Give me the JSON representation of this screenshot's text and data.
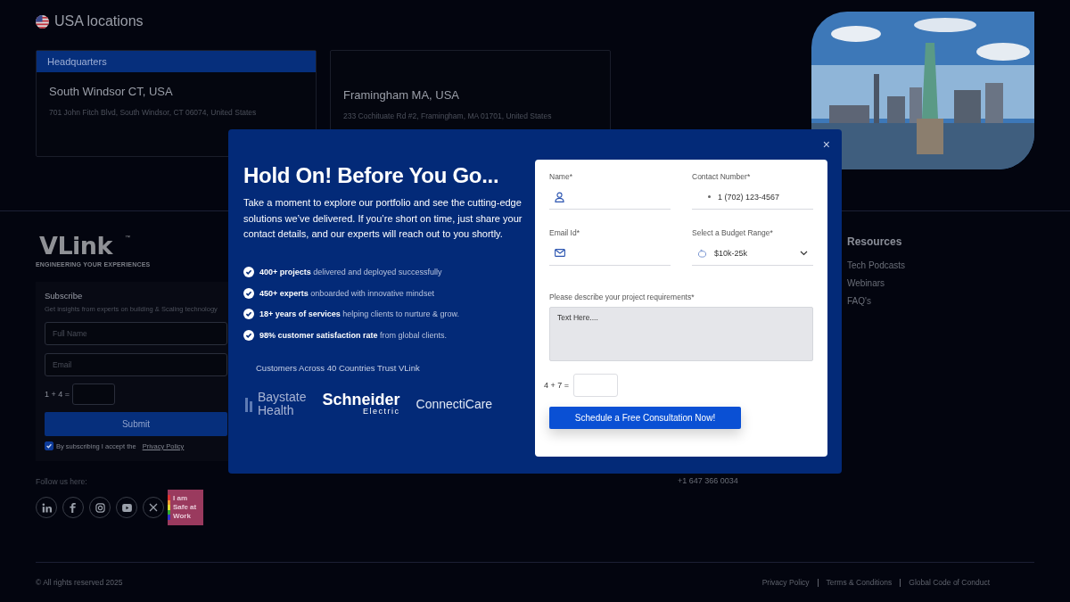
{
  "locations": {
    "title": "USA locations",
    "offices": [
      {
        "tag": "Headquarters",
        "city": "South Windsor CT, USA",
        "address": "701 John Fitch Blvd, South Windsor, CT 06074, United States"
      },
      {
        "city": "Framingham MA, USA",
        "address": "233 Cochituate Rd #2, Framingham, MA 01701, United States"
      }
    ]
  },
  "footer": {
    "logo": {
      "name": "VLink",
      "mark": "™",
      "tagline": "ENGINEERING YOUR EXPERIENCES"
    },
    "subscribe": {
      "title": "Subscribe",
      "subtitle": "Get insights from experts on building & Scaling technology",
      "name_placeholder": "Full Name",
      "email_placeholder": "Email",
      "captcha": "1 + 4 =",
      "button": "Submit",
      "consent_checked": true,
      "consent_text": "By subscribing I accept the",
      "consent_link": "Privacy Policy"
    },
    "follow_label": "Follow us here:",
    "social_links": [
      {
        "kind": "linkedin"
      },
      {
        "kind": "facebook"
      },
      {
        "kind": "instagram"
      },
      {
        "kind": "youtube"
      },
      {
        "kind": "x"
      }
    ],
    "badge": "I am Safe at Work",
    "phone": "+1 647 366 0034",
    "resources": {
      "title": "Resources",
      "links": [
        "Tech Podcasts",
        "Webinars",
        "FAQ's"
      ]
    },
    "copyright": "© All rights reserved 2025",
    "legal_links": [
      "Privacy Policy",
      "Terms & Conditions",
      "Global Code of Conduct"
    ]
  },
  "modal": {
    "close": "×",
    "title": "Hold On! Before You Go...",
    "intro": "Take a moment to explore our portfolio and see the cutting-edge solutions we’ve delivered. If you’re short on time, just share your contact details, and our experts will reach out to you shortly.",
    "highlights": [
      "**400+ projects** delivered and deployed successfully",
      "**450+ experts** onboarded with innovative mindset",
      "**18+ years of services** helping clients to nurture & grow.",
      "**98% customer satisfaction rate** from global clients."
    ],
    "trust_text": "Customers Across 40 Countries Trust VLink",
    "client_logos": [
      {
        "kind": "baystate",
        "lines": [
          "Baystate",
          "Health"
        ]
      },
      {
        "kind": "schneider",
        "lines": [
          "Schneider",
          "Electric"
        ]
      },
      {
        "kind": "connecticare",
        "lines": [
          "ConnectiCare"
        ]
      }
    ],
    "form": {
      "fields": [
        {
          "kind": "name",
          "label": "Name*"
        },
        {
          "kind": "phone",
          "label": "Contact Number*",
          "value": "1 (702) 123-4567"
        },
        {
          "kind": "email",
          "label": "Email Id*"
        },
        {
          "kind": "budget",
          "label": "Select a Budget Range*",
          "value": "$10k-25k"
        }
      ],
      "requirements_label": "Please describe your project requirements*",
      "requirements_placeholder": "Text Here....",
      "captcha": "4 + 7 =",
      "button": "Schedule a Free Consultation Now!"
    }
  }
}
